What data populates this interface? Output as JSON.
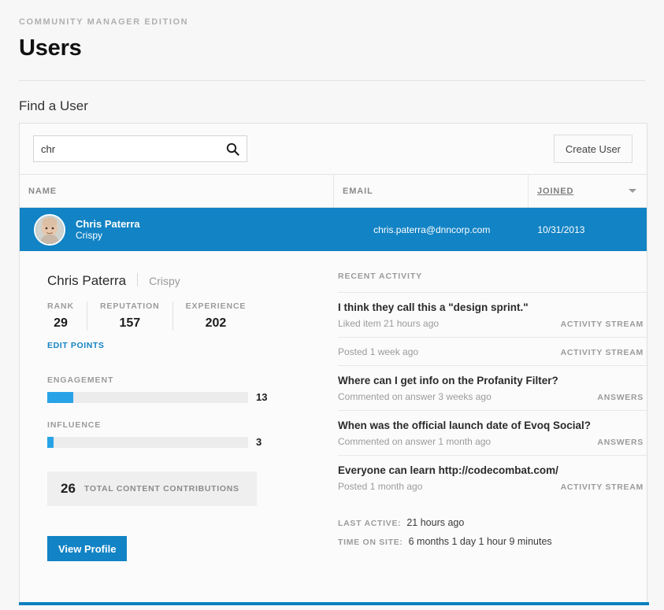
{
  "header": {
    "edition": "COMMUNITY MANAGER EDITION",
    "title": "Users",
    "section_title": "Find a User"
  },
  "search": {
    "value": "chr",
    "placeholder": "",
    "icon": "search-icon",
    "create_user_label": "Create User"
  },
  "table": {
    "columns": {
      "name": "NAME",
      "email": "EMAIL",
      "joined": "JOINED"
    },
    "sort_icon": "chevron-down-icon",
    "selected_row": {
      "name": "Chris Paterra",
      "alias": "Crispy",
      "email": "chris.paterra@dnncorp.com",
      "joined": "10/31/2013"
    }
  },
  "detail": {
    "name": "Chris Paterra",
    "alias": "Crispy",
    "stats": [
      {
        "label": "RANK",
        "value": "29"
      },
      {
        "label": "REPUTATION",
        "value": "157"
      },
      {
        "label": "EXPERIENCE",
        "value": "202"
      }
    ],
    "edit_points_label": "EDIT POINTS",
    "meters": [
      {
        "label": "ENGAGEMENT",
        "value": "13",
        "percent": 13
      },
      {
        "label": "INFLUENCE",
        "value": "3",
        "percent": 3
      }
    ],
    "contributions": {
      "count": "26",
      "label": "TOTAL CONTENT CONTRIBUTIONS"
    },
    "view_profile_label": "View Profile"
  },
  "activity": {
    "title": "RECENT ACTIVITY",
    "items": [
      {
        "headline": "I think they call this a \"design sprint.\"",
        "sub": "Liked item 21 hours ago",
        "tag": "ACTIVITY STREAM"
      },
      {
        "headline": "",
        "sub": "Posted 1 week ago",
        "tag": "ACTIVITY STREAM"
      },
      {
        "headline": "Where can I get info on the Profanity Filter?",
        "sub": "Commented on answer 3 weeks ago",
        "tag": "ANSWERS"
      },
      {
        "headline": "When was the official launch date of Evoq Social?",
        "sub": "Commented on answer 1 month ago",
        "tag": "ANSWERS"
      },
      {
        "headline": "Everyone can learn http://codecombat.com/",
        "sub": "Posted 1 month ago",
        "tag": "ACTIVITY STREAM"
      }
    ],
    "footer": [
      {
        "label": "LAST ACTIVE:",
        "value": "21 hours ago"
      },
      {
        "label": "TIME ON SITE:",
        "value": "6 months 1 day 1 hour 9 minutes"
      }
    ]
  },
  "colors": {
    "accent_blue": "#1283c4",
    "meter_blue": "#29a3e8",
    "bottom_bar": "#0b7fc0"
  }
}
